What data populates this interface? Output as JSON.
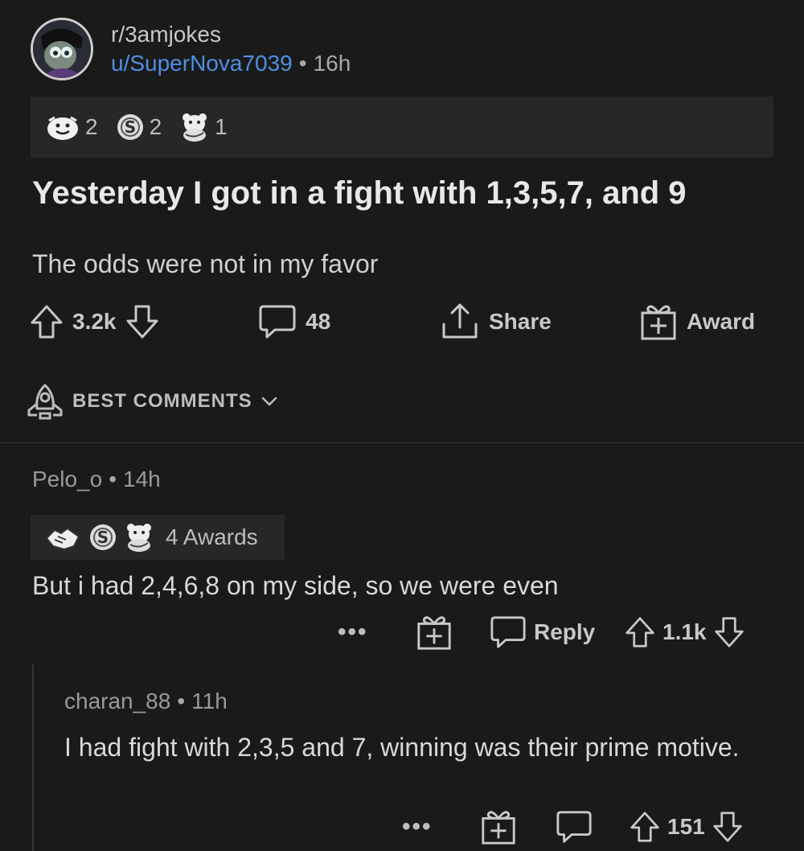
{
  "post": {
    "subreddit": "r/3amjokes",
    "author": "u/SuperNova7039",
    "separator": "•",
    "age": "16h",
    "awards": [
      {
        "icon": "wholesome-face-award-icon",
        "count": "2"
      },
      {
        "icon": "silver-coin-award-icon",
        "count": "2"
      },
      {
        "icon": "bear-hug-award-icon",
        "count": "1"
      }
    ],
    "title": "Yesterday I got in a fight with 1,3,5,7, and 9",
    "body": "The odds were not in my favor",
    "actions": {
      "upvotes": "3.2k",
      "comments": "48",
      "share_label": "Share",
      "award_label": "Award"
    }
  },
  "sort": {
    "label": "BEST COMMENTS"
  },
  "comments": [
    {
      "author": "Pelo_o",
      "separator": "•",
      "age": "14h",
      "awards_label": "4 Awards",
      "text": "But i had 2,4,6,8 on my side, so we were even",
      "more": "•••",
      "reply_label": "Reply",
      "votes": "1.1k"
    },
    {
      "author": "charan_88",
      "separator": "•",
      "age": "11h",
      "text": "I had fight with 2,3,5 and 7, winning was their prime motive.",
      "more": "•••",
      "votes": "151"
    }
  ],
  "colors": {
    "background": "#1a1a1b",
    "username_link": "#4f8fe0",
    "award_bar": "#272729"
  }
}
